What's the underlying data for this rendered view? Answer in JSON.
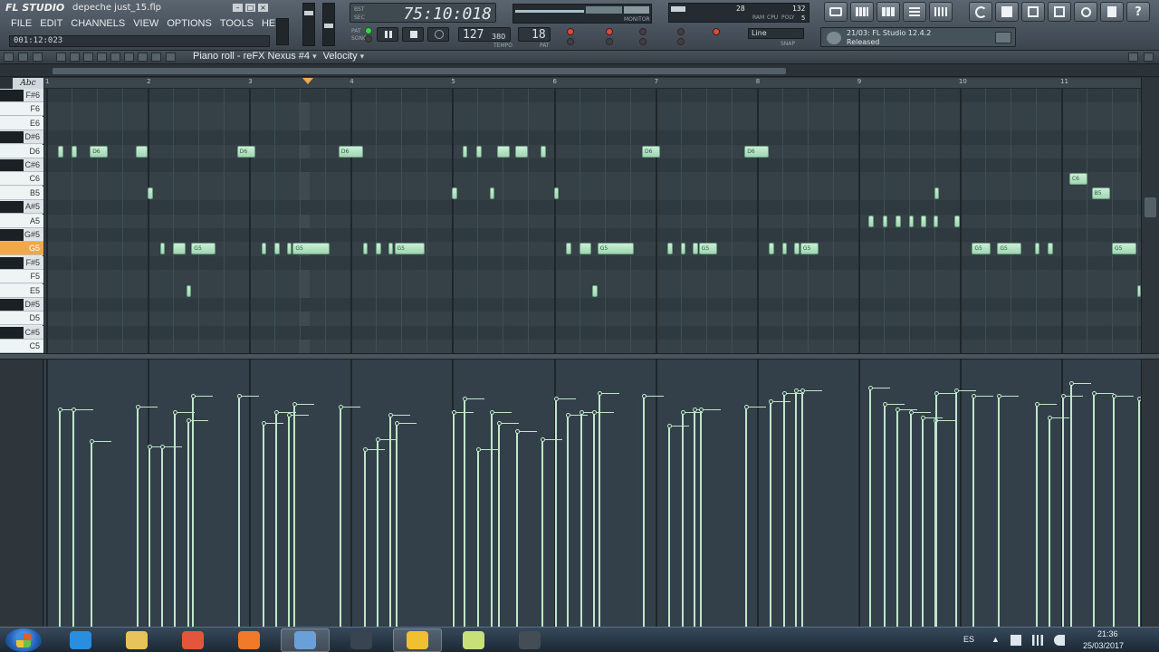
{
  "window": {
    "app_logo": "FL STUDIO",
    "file_name": "depeche just_15.flp"
  },
  "menu": [
    "FILE",
    "EDIT",
    "CHANNELS",
    "VIEW",
    "OPTIONS",
    "TOOLS",
    "HELP"
  ],
  "hint_bar": "001:12:023",
  "transport": {
    "time_display": "75:10:018",
    "tempo": "127",
    "tempo_decimal": "380",
    "pattern": "18",
    "time_labels": [
      "BST",
      "SEC"
    ],
    "mode_labels": [
      "PAT",
      "SONG"
    ],
    "tempo_label": "TEMPO",
    "pattern_label": "PAT",
    "monitor_label": "MONITOR"
  },
  "meters": {
    "cpu_value": "28",
    "poly_value": "132",
    "poly_sub": "5",
    "labels": [
      "RAM",
      "CPU",
      "POLY"
    ]
  },
  "snap_select": "Line",
  "snap_sub": "SNAP",
  "hint_panel": {
    "line1": "21/03: FL Studio 12.4.2",
    "line2": "Released"
  },
  "piano_roll": {
    "title": "Piano roll - reFX Nexus #4",
    "target": "Velocity",
    "snap_label": "Abc"
  },
  "ruler": [
    "1",
    "2",
    "3",
    "4",
    "5",
    "6",
    "7",
    "8",
    "9",
    "10",
    "11"
  ],
  "keys": [
    {
      "label": "F#6",
      "black": true
    },
    {
      "label": "F6",
      "black": false
    },
    {
      "label": "E6",
      "black": false
    },
    {
      "label": "D#6",
      "black": true
    },
    {
      "label": "D6",
      "black": false
    },
    {
      "label": "C#6",
      "black": true
    },
    {
      "label": "C6",
      "black": false
    },
    {
      "label": "B5",
      "black": false
    },
    {
      "label": "A#5",
      "black": true
    },
    {
      "label": "A5",
      "black": false
    },
    {
      "label": "G#5",
      "black": true
    },
    {
      "label": "G5",
      "black": false,
      "highlight": true
    },
    {
      "label": "F#5",
      "black": true
    },
    {
      "label": "F5",
      "black": false
    },
    {
      "label": "E5",
      "black": false
    },
    {
      "label": "D#5",
      "black": true
    },
    {
      "label": "D5",
      "black": false
    },
    {
      "label": "C#5",
      "black": true
    },
    {
      "label": "C5",
      "black": false
    }
  ],
  "notes": [
    {
      "row": 4,
      "start": 0.12,
      "len": 0.05,
      "label": ""
    },
    {
      "row": 4,
      "start": 0.25,
      "len": 0.05,
      "label": ""
    },
    {
      "row": 4,
      "start": 0.43,
      "len": 0.18,
      "label": "D6"
    },
    {
      "row": 4,
      "start": 0.88,
      "len": 0.12,
      "label": ""
    },
    {
      "row": 4,
      "start": 1.88,
      "len": 0.18,
      "label": "D6"
    },
    {
      "row": 4,
      "start": 2.88,
      "len": 0.24,
      "label": "D6"
    },
    {
      "row": 4,
      "start": 4.1,
      "len": 0.05,
      "label": ""
    },
    {
      "row": 4,
      "start": 4.24,
      "len": 0.05,
      "label": ""
    },
    {
      "row": 4,
      "start": 4.44,
      "len": 0.13,
      "label": ""
    },
    {
      "row": 4,
      "start": 4.62,
      "len": 0.13,
      "label": ""
    },
    {
      "row": 4,
      "start": 4.87,
      "len": 0.05,
      "label": ""
    },
    {
      "row": 4,
      "start": 5.87,
      "len": 0.18,
      "label": "D6"
    },
    {
      "row": 4,
      "start": 6.88,
      "len": 0.24,
      "label": "D6"
    },
    {
      "row": 6,
      "start": 10.08,
      "len": 0.18,
      "label": "C6"
    },
    {
      "row": 7,
      "start": 1.0,
      "len": 0.05,
      "label": ""
    },
    {
      "row": 7,
      "start": 4.0,
      "len": 0.05,
      "label": ""
    },
    {
      "row": 7,
      "start": 4.37,
      "len": 0.05,
      "label": ""
    },
    {
      "row": 7,
      "start": 5.0,
      "len": 0.05,
      "label": ""
    },
    {
      "row": 7,
      "start": 8.75,
      "len": 0.05,
      "label": ""
    },
    {
      "row": 7,
      "start": 10.3,
      "len": 0.18,
      "label": "B5"
    },
    {
      "row": 9,
      "start": 8.1,
      "len": 0.05,
      "label": ""
    },
    {
      "row": 9,
      "start": 8.24,
      "len": 0.05,
      "label": ""
    },
    {
      "row": 9,
      "start": 8.37,
      "len": 0.05,
      "label": ""
    },
    {
      "row": 9,
      "start": 8.5,
      "len": 0.05,
      "label": ""
    },
    {
      "row": 9,
      "start": 8.62,
      "len": 0.05,
      "label": ""
    },
    {
      "row": 9,
      "start": 8.74,
      "len": 0.05,
      "label": ""
    },
    {
      "row": 9,
      "start": 8.95,
      "len": 0.05,
      "label": ""
    },
    {
      "row": 11,
      "start": 1.12,
      "len": 0.05,
      "label": ""
    },
    {
      "row": 11,
      "start": 1.25,
      "len": 0.12,
      "label": ""
    },
    {
      "row": 11,
      "start": 1.43,
      "len": 0.24,
      "label": "G5"
    },
    {
      "row": 11,
      "start": 2.12,
      "len": 0.05,
      "label": ""
    },
    {
      "row": 11,
      "start": 2.25,
      "len": 0.05,
      "label": ""
    },
    {
      "row": 11,
      "start": 2.37,
      "len": 0.05,
      "label": ""
    },
    {
      "row": 11,
      "start": 2.43,
      "len": 0.36,
      "label": "G5"
    },
    {
      "row": 11,
      "start": 3.12,
      "len": 0.05,
      "label": ""
    },
    {
      "row": 11,
      "start": 3.25,
      "len": 0.05,
      "label": ""
    },
    {
      "row": 11,
      "start": 3.37,
      "len": 0.05,
      "label": ""
    },
    {
      "row": 11,
      "start": 3.43,
      "len": 0.3,
      "label": "G5"
    },
    {
      "row": 11,
      "start": 5.12,
      "len": 0.05,
      "label": ""
    },
    {
      "row": 11,
      "start": 5.25,
      "len": 0.12,
      "label": ""
    },
    {
      "row": 11,
      "start": 5.43,
      "len": 0.36,
      "label": "G5"
    },
    {
      "row": 11,
      "start": 6.12,
      "len": 0.05,
      "label": ""
    },
    {
      "row": 11,
      "start": 6.25,
      "len": 0.05,
      "label": ""
    },
    {
      "row": 11,
      "start": 6.37,
      "len": 0.05,
      "label": ""
    },
    {
      "row": 11,
      "start": 6.43,
      "len": 0.18,
      "label": "G5"
    },
    {
      "row": 11,
      "start": 7.12,
      "len": 0.05,
      "label": ""
    },
    {
      "row": 11,
      "start": 7.25,
      "len": 0.05,
      "label": ""
    },
    {
      "row": 11,
      "start": 7.37,
      "len": 0.05,
      "label": ""
    },
    {
      "row": 11,
      "start": 7.43,
      "len": 0.18,
      "label": "G5"
    },
    {
      "row": 11,
      "start": 9.12,
      "len": 0.18,
      "label": "G5"
    },
    {
      "row": 11,
      "start": 9.37,
      "len": 0.24,
      "label": "G5"
    },
    {
      "row": 11,
      "start": 9.74,
      "len": 0.05,
      "label": ""
    },
    {
      "row": 11,
      "start": 9.87,
      "len": 0.05,
      "label": ""
    },
    {
      "row": 11,
      "start": 10.5,
      "len": 0.24,
      "label": "G5"
    },
    {
      "row": 14,
      "start": 1.38,
      "len": 0.05,
      "label": ""
    },
    {
      "row": 14,
      "start": 5.38,
      "len": 0.05,
      "label": ""
    },
    {
      "row": 14,
      "start": 10.75,
      "len": 0.05,
      "label": ""
    }
  ],
  "velocities": [
    {
      "x": 0.12,
      "v": 0.81
    },
    {
      "x": 0.25,
      "v": 0.81
    },
    {
      "x": 0.43,
      "v": 0.69
    },
    {
      "x": 0.88,
      "v": 0.82
    },
    {
      "x": 1.0,
      "v": 0.67
    },
    {
      "x": 1.12,
      "v": 0.67
    },
    {
      "x": 1.25,
      "v": 0.8
    },
    {
      "x": 1.38,
      "v": 0.77
    },
    {
      "x": 1.43,
      "v": 0.86
    },
    {
      "x": 1.88,
      "v": 0.86
    },
    {
      "x": 2.12,
      "v": 0.76
    },
    {
      "x": 2.25,
      "v": 0.8
    },
    {
      "x": 2.37,
      "v": 0.79
    },
    {
      "x": 2.43,
      "v": 0.83
    },
    {
      "x": 2.88,
      "v": 0.82
    },
    {
      "x": 3.12,
      "v": 0.66
    },
    {
      "x": 3.25,
      "v": 0.7
    },
    {
      "x": 3.37,
      "v": 0.79
    },
    {
      "x": 3.43,
      "v": 0.76
    },
    {
      "x": 4.0,
      "v": 0.8
    },
    {
      "x": 4.1,
      "v": 0.85
    },
    {
      "x": 4.24,
      "v": 0.66
    },
    {
      "x": 4.37,
      "v": 0.8
    },
    {
      "x": 4.44,
      "v": 0.76
    },
    {
      "x": 4.62,
      "v": 0.73
    },
    {
      "x": 4.87,
      "v": 0.7
    },
    {
      "x": 5.0,
      "v": 0.85
    },
    {
      "x": 5.12,
      "v": 0.79
    },
    {
      "x": 5.25,
      "v": 0.8
    },
    {
      "x": 5.38,
      "v": 0.8
    },
    {
      "x": 5.43,
      "v": 0.87
    },
    {
      "x": 5.87,
      "v": 0.86
    },
    {
      "x": 6.12,
      "v": 0.75
    },
    {
      "x": 6.25,
      "v": 0.8
    },
    {
      "x": 6.37,
      "v": 0.81
    },
    {
      "x": 6.43,
      "v": 0.81
    },
    {
      "x": 6.88,
      "v": 0.82
    },
    {
      "x": 7.12,
      "v": 0.84
    },
    {
      "x": 7.25,
      "v": 0.87
    },
    {
      "x": 7.37,
      "v": 0.88
    },
    {
      "x": 7.43,
      "v": 0.88
    },
    {
      "x": 8.1,
      "v": 0.89
    },
    {
      "x": 8.24,
      "v": 0.83
    },
    {
      "x": 8.37,
      "v": 0.81
    },
    {
      "x": 8.5,
      "v": 0.8
    },
    {
      "x": 8.62,
      "v": 0.78
    },
    {
      "x": 8.74,
      "v": 0.77
    },
    {
      "x": 8.75,
      "v": 0.87
    },
    {
      "x": 8.95,
      "v": 0.88
    },
    {
      "x": 9.12,
      "v": 0.86
    },
    {
      "x": 9.37,
      "v": 0.86
    },
    {
      "x": 9.74,
      "v": 0.83
    },
    {
      "x": 9.87,
      "v": 0.78
    },
    {
      "x": 10.0,
      "v": 0.86
    },
    {
      "x": 10.08,
      "v": 0.91
    },
    {
      "x": 10.3,
      "v": 0.87
    },
    {
      "x": 10.5,
      "v": 0.86
    },
    {
      "x": 10.75,
      "v": 0.85
    }
  ],
  "taskbar": {
    "apps": [
      "ie-icon",
      "explorer-icon",
      "media-icon",
      "firefox-icon",
      "network-icon",
      "monitor-icon",
      "fl-studio-icon",
      "notes-icon",
      "video-icon"
    ],
    "language": "ES",
    "time": "21:36",
    "date": "25/03/2017"
  },
  "colors": {
    "note": "#b6e4c4",
    "highlight_key": "#f0a94a",
    "grid_bg": "#354147",
    "velocity": "#bfe6c8"
  }
}
